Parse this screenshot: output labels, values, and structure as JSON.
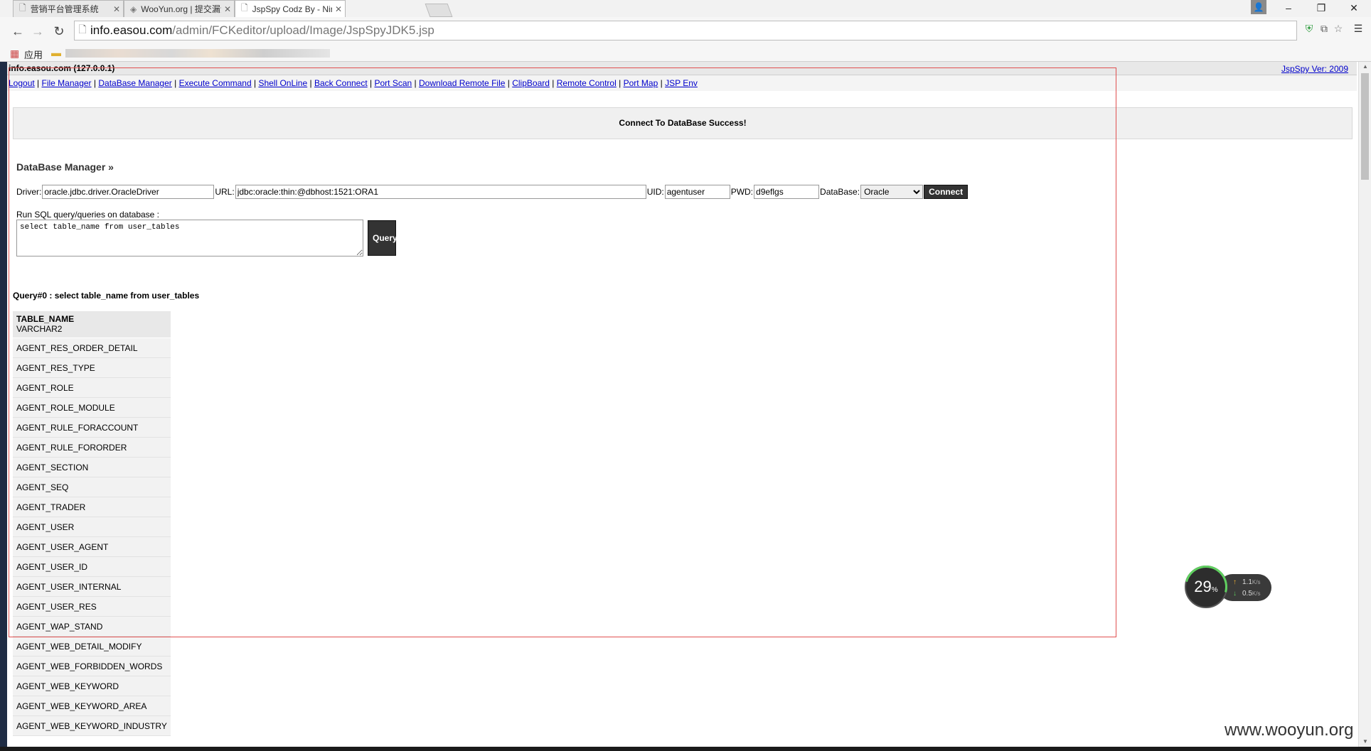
{
  "browser": {
    "tabs": [
      {
        "title": "营销平台管理系统",
        "icon": "page-icon",
        "active": false
      },
      {
        "title": "WooYun.org | 提交漏洞",
        "icon": "wooyun-favicon",
        "active": false
      },
      {
        "title": "JspSpy Codz By - Ninty",
        "icon": "page-icon",
        "active": true
      }
    ],
    "tab_close": "✕",
    "window_controls": {
      "minimize": "–",
      "restore": "❐",
      "close": "✕"
    },
    "url_host": "info.easou.com",
    "url_path": "/admin/FCKeditor/upload/Image/JspSpyJDK5.jsp",
    "bookmarks_apps_label": "应用"
  },
  "page": {
    "host_label": "info.easou.com (127.0.0.1)",
    "version_link": "JspSpy Ver: 2009",
    "menu": [
      "Logout",
      "File Manager",
      "DataBase Manager",
      "Execute Command",
      "Shell OnLine",
      "Back Connect",
      "Port Scan",
      "Download Remote File",
      "ClipBoard",
      "Remote Control",
      "Port Map",
      "JSP Env"
    ],
    "menu_separator": "|",
    "success_message": "Connect To DataBase Success!",
    "db_heading": "DataBase Manager »",
    "form": {
      "driver_label": "Driver:",
      "driver_value": "oracle.jdbc.driver.OracleDriver",
      "url_label": "URL:",
      "url_value": "jdbc:oracle:thin:@dbhost:1521:ORA1",
      "uid_label": "UID:",
      "uid_value": "agentuser",
      "pwd_label": "PWD:",
      "pwd_value": "d9eflgs",
      "database_label": "DataBase:",
      "database_selected": "Oracle",
      "connect_label": "Connect"
    },
    "sql_label": "Run SQL query/queries on database :",
    "sql_text": "select table_name from user_tables",
    "query_button": "Query",
    "query_title": "Query#0 : select table_name from user_tables",
    "table": {
      "column_name": "TABLE_NAME",
      "column_type": "VARCHAR2",
      "rows": [
        "AGENT_RES_ORDER_DETAIL",
        "AGENT_RES_TYPE",
        "AGENT_ROLE",
        "AGENT_ROLE_MODULE",
        "AGENT_RULE_FORACCOUNT",
        "AGENT_RULE_FORORDER",
        "AGENT_SECTION",
        "AGENT_SEQ",
        "AGENT_TRADER",
        "AGENT_USER",
        "AGENT_USER_AGENT",
        "AGENT_USER_ID",
        "AGENT_USER_INTERNAL",
        "AGENT_USER_RES",
        "AGENT_WAP_STAND",
        "AGENT_WEB_DETAIL_MODIFY",
        "AGENT_WEB_FORBIDDEN_WORDS",
        "AGENT_WEB_KEYWORD",
        "AGENT_WEB_KEYWORD_AREA",
        "AGENT_WEB_KEYWORD_INDUSTRY"
      ]
    }
  },
  "speed_widget": {
    "percent": "29",
    "percent_sign": "%",
    "upload": "1.1",
    "download": "0.5",
    "unit": "K/s"
  },
  "watermark": "www.wooyun.org",
  "colors": {
    "annotation_frame": "#e05050",
    "link": "#0000cc",
    "button_dark": "#333333"
  }
}
